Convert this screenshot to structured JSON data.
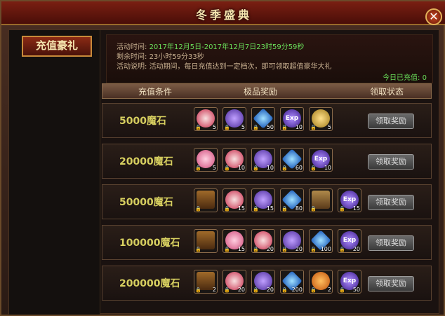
{
  "window": {
    "title": "冬季盛典",
    "close_label": "✕"
  },
  "sidebar": {
    "tab_label": "充值豪礼"
  },
  "info": {
    "time_label": "活动时间:",
    "time_value": "2017年12月5日-2017年12月7日23时59分59秒",
    "remain_label": "剩余时间:",
    "remain_value": "23小时59分33秒",
    "desc_label": "活动说明:",
    "desc_value": "活动期间，每日充值达到一定档次，即可领取超值豪华大礼",
    "today_label": "今日已充值:",
    "today_value": "0"
  },
  "table_header": {
    "condition": "充值条件",
    "rewards": "极品奖励",
    "status": "领取状态"
  },
  "rows": [
    {
      "condition": "5000魔石",
      "claim_label": "领取奖励",
      "items": [
        {
          "icon": "gift-box-icon",
          "count": "5"
        },
        {
          "icon": "magic-stone-icon",
          "count": "5"
        },
        {
          "icon": "blue-gem-icon",
          "count": "50"
        },
        {
          "icon": "exp-orb-icon",
          "count": "10"
        },
        {
          "icon": "golden-key-icon",
          "count": "5"
        }
      ]
    },
    {
      "condition": "20000魔石",
      "claim_label": "领取奖励",
      "items": [
        {
          "icon": "lotus-icon",
          "count": "5"
        },
        {
          "icon": "gift-box-icon",
          "count": "10"
        },
        {
          "icon": "magic-stone-icon",
          "count": "10"
        },
        {
          "icon": "blue-gem-icon",
          "count": "60"
        },
        {
          "icon": "exp-orb-icon",
          "count": "10"
        }
      ]
    },
    {
      "condition": "50000魔石",
      "claim_label": "领取奖励",
      "items": [
        {
          "icon": "treasure-chest-icon",
          "count": ""
        },
        {
          "icon": "gift-box-icon",
          "count": "15"
        },
        {
          "icon": "magic-stone-icon",
          "count": "15"
        },
        {
          "icon": "blue-gem-icon",
          "count": "80"
        },
        {
          "icon": "bronze-tablet-icon",
          "count": ""
        },
        {
          "icon": "exp-orb-icon",
          "count": "15"
        }
      ]
    },
    {
      "condition": "100000魔石",
      "claim_label": "领取奖励",
      "items": [
        {
          "icon": "treasure-chest-icon",
          "count": ""
        },
        {
          "icon": "lotus-icon",
          "count": "15"
        },
        {
          "icon": "gift-box-icon",
          "count": "20"
        },
        {
          "icon": "magic-stone-icon",
          "count": "20"
        },
        {
          "icon": "blue-gem-icon",
          "count": "100"
        },
        {
          "icon": "exp-orb-icon",
          "count": "20"
        }
      ]
    },
    {
      "condition": "200000魔石",
      "claim_label": "领取奖励",
      "items": [
        {
          "icon": "treasure-chest-icon",
          "count": "2"
        },
        {
          "icon": "gift-box-icon",
          "count": "20"
        },
        {
          "icon": "magic-stone-icon",
          "count": "20"
        },
        {
          "icon": "blue-gem-icon",
          "count": "200"
        },
        {
          "icon": "orange-crystal-icon",
          "count": "2"
        },
        {
          "icon": "exp-orb-icon",
          "count": "50"
        }
      ]
    }
  ],
  "colors": {
    "accent": "#c88a3a",
    "condition_text": "#d8d060",
    "green": "#6adf5a"
  }
}
